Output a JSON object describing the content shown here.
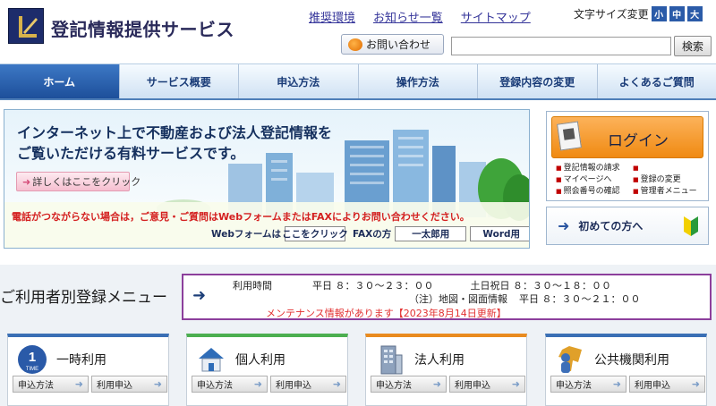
{
  "header": {
    "site_title": "登記情報提供サービス",
    "links": [
      "推奨環境",
      "お知らせ一覧",
      "サイトマップ"
    ],
    "font_size_label": "文字サイズ変更",
    "font_size_options": [
      "小",
      "中",
      "大"
    ],
    "contact_label": "お問い合わせ",
    "search_value": "",
    "search_button": "検索"
  },
  "nav": {
    "items": [
      "ホーム",
      "サービス概要",
      "申込方法",
      "操作方法",
      "登録内容の変更",
      "よくあるご質問"
    ],
    "active_index": 0
  },
  "banner": {
    "line1": "インターネット上で不動産および法人登記情報を",
    "line2": "ご覧いただける有料サービスです。",
    "detail_button": "詳しくはここをクリック",
    "notice": "電話がつながらない場合は，ご意見・ご質問はWebフォームまたはFAXによりお問い合わせください。",
    "webform_label": "Webフォームは",
    "webform_button": "ここをクリック",
    "fax_label": "FAXの方",
    "fax_button_1": "一太郎用",
    "fax_button_2": "Word用"
  },
  "login": {
    "button_label": "ログイン",
    "links": [
      "登記情報の請求",
      "マイページへ",
      "登録の変更",
      "照会番号の確認",
      "管理者メニュー"
    ]
  },
  "first_time": {
    "label": "初めての方へ"
  },
  "registration": {
    "title": "ご利用者別登録メニュー",
    "hours_label": "利用時間",
    "weekday_label": "平日",
    "weekday_hours": "８：３０～２３：００",
    "holiday_label": "土日祝日",
    "holiday_hours": "８：３０～１８：００",
    "note_label": "（注）地図・図面情報",
    "note_weekday_label": "平日",
    "note_hours": "８：３０～２１：００",
    "maintenance": "メンテナンス情報があります【2023年8月14日更新】"
  },
  "cards": [
    {
      "title": "一時利用",
      "badge_text": "1",
      "badge_sub": "TIME",
      "accent": "#3a6fb5",
      "btn1": "申込方法",
      "btn2": "利用申込"
    },
    {
      "title": "個人利用",
      "accent": "#4caf50",
      "btn1": "申込方法",
      "btn2": "利用申込"
    },
    {
      "title": "法人利用",
      "accent": "#e98b1f",
      "btn1": "申込方法",
      "btn2": "利用申込"
    },
    {
      "title": "公共機関利用",
      "accent": "#3a6fb5",
      "btn1": "申込方法",
      "btn2": "利用申込"
    }
  ],
  "colors": {
    "nav_active": "#1d4f9a",
    "login_orange": "#f08a12",
    "notice_red": "#d42020",
    "hours_border": "#8c3f9c"
  }
}
